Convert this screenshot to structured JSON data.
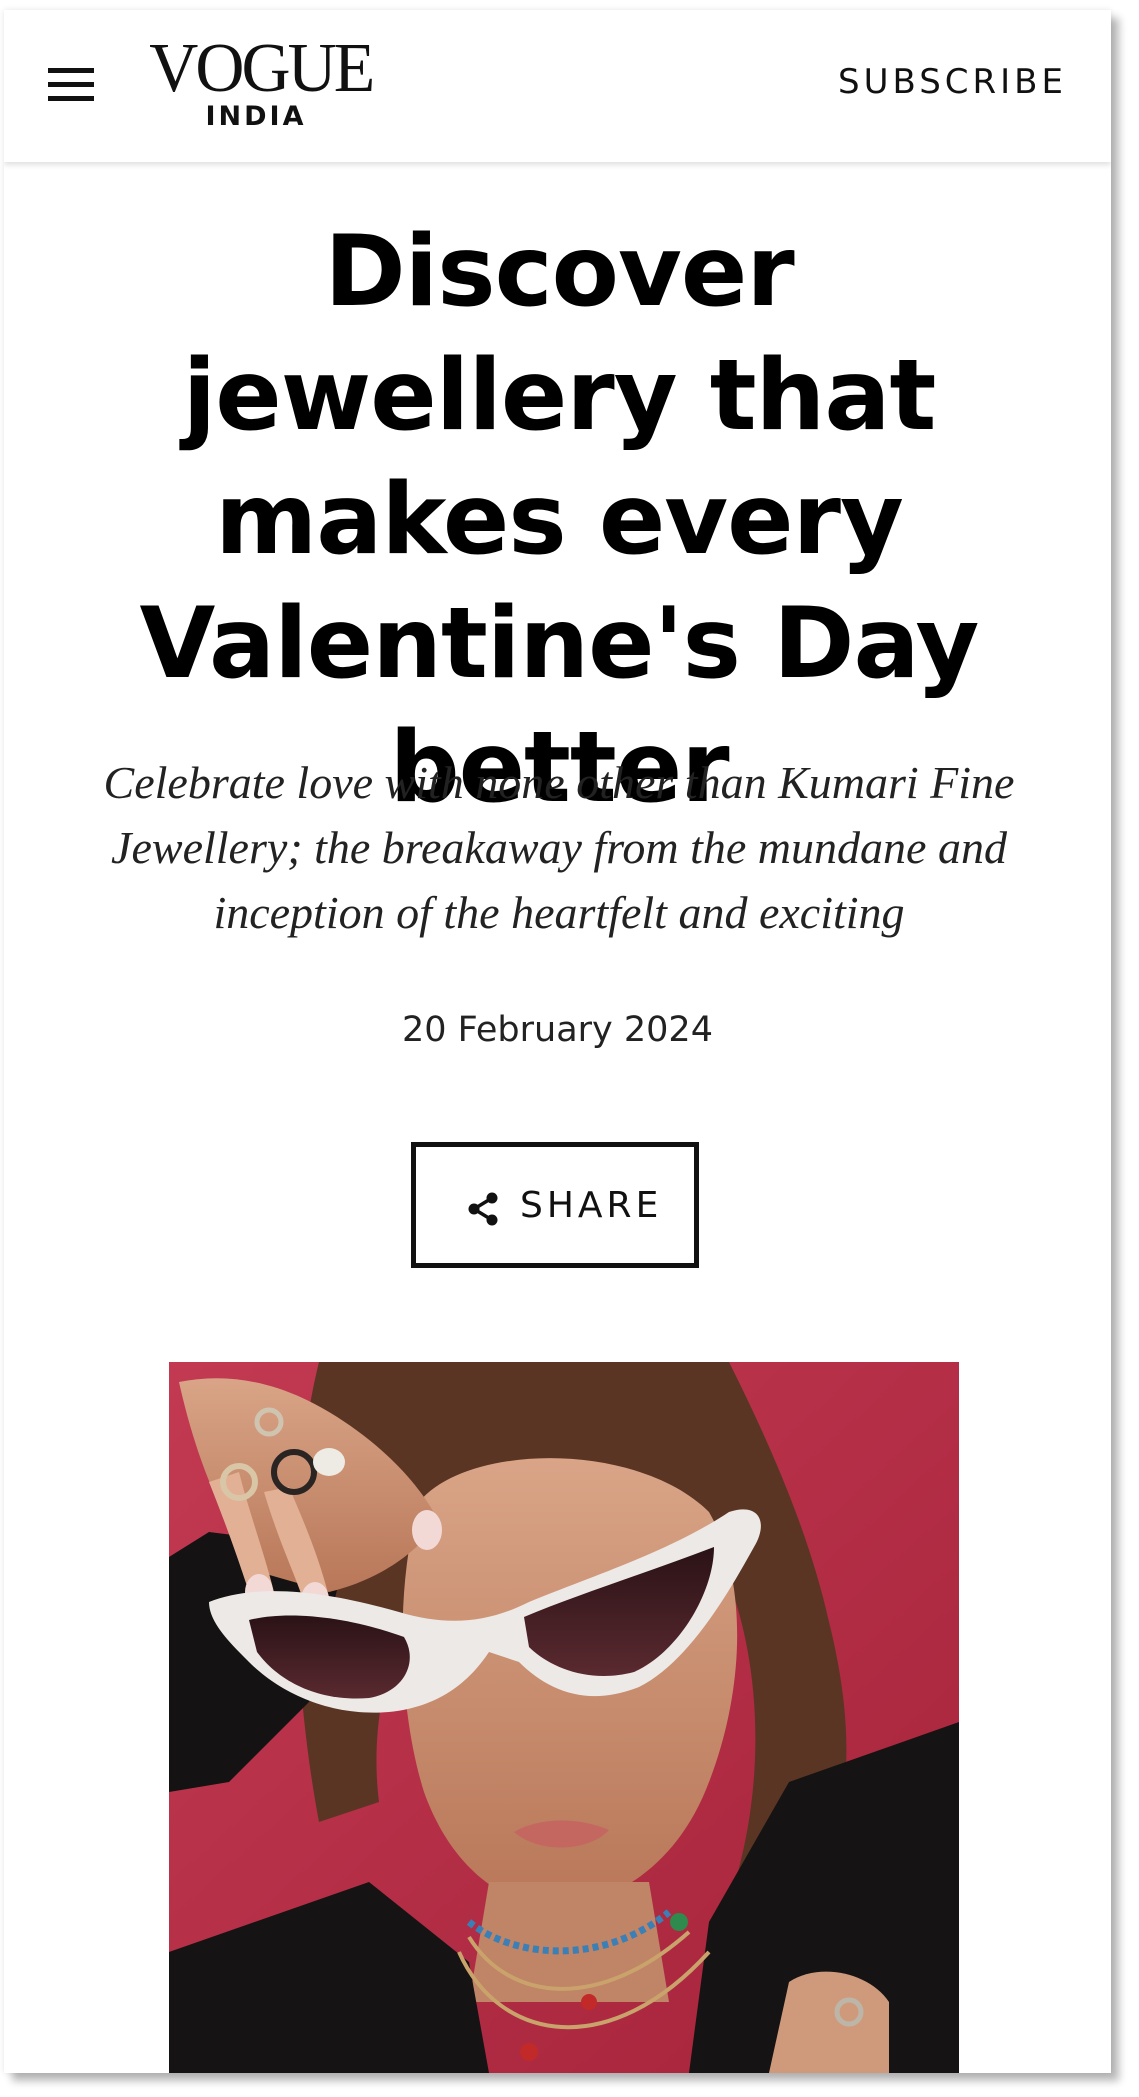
{
  "header": {
    "logo_main": "VOGUE",
    "logo_sub": "INDIA",
    "subscribe_label": "SUBSCRIBE"
  },
  "article": {
    "headline": "Discover jewellery that makes every Valentine's Day better",
    "dek": "Celebrate love with none other than Kumari Fine Jewellery; the breakaway from the mundane and inception of the heartfelt and exciting",
    "date": "20 February 2024",
    "share_label": "SHARE"
  },
  "hero_image": {
    "background_color": "#b42a40"
  }
}
